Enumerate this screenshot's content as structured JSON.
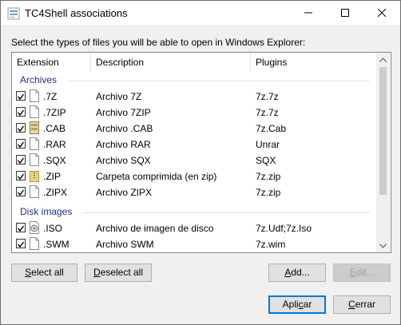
{
  "window": {
    "title": "TC4Shell associations",
    "prompt": "Select the types of files you will be able to open in Windows Explorer:"
  },
  "columns": {
    "extension": "Extension",
    "description": "Description",
    "plugins": "Plugins"
  },
  "groups": [
    {
      "label": "Archives",
      "rows": [
        {
          "ext": ".7Z",
          "desc": "Archivo 7Z",
          "plugin": "7z.7z",
          "checked": true,
          "icon": "document-icon"
        },
        {
          "ext": ".7ZIP",
          "desc": "Archivo 7ZIP",
          "plugin": "7z.7z",
          "checked": true,
          "icon": "document-icon"
        },
        {
          "ext": ".CAB",
          "desc": "Archivo .CAB",
          "plugin": "7z.Cab",
          "checked": true,
          "icon": "cab-file-icon"
        },
        {
          "ext": ".RAR",
          "desc": "Archivo RAR",
          "plugin": "Unrar",
          "checked": true,
          "icon": "document-icon"
        },
        {
          "ext": ".SQX",
          "desc": "Archivo SQX",
          "plugin": "SQX",
          "checked": true,
          "icon": "document-icon"
        },
        {
          "ext": ".ZIP",
          "desc": "Carpeta comprimida (en zip)",
          "plugin": "7z.zip",
          "checked": true,
          "icon": "zip-folder-icon"
        },
        {
          "ext": ".ZIPX",
          "desc": "Archivo ZIPX",
          "plugin": "7z.zip",
          "checked": true,
          "icon": "document-icon"
        }
      ]
    },
    {
      "label": "Disk images",
      "rows": [
        {
          "ext": ".ISO",
          "desc": "Archivo de imagen de disco",
          "plugin": "7z.Udf;7z.Iso",
          "checked": true,
          "icon": "disc-image-icon"
        },
        {
          "ext": ".SWM",
          "desc": "Archivo SWM",
          "plugin": "7z.wim",
          "checked": true,
          "icon": "document-icon"
        }
      ]
    }
  ],
  "buttons": {
    "select_all": {
      "accel": "S",
      "rest": "elect all"
    },
    "deselect_all": {
      "accel": "D",
      "rest": "eselect all"
    },
    "add": {
      "accel": "A",
      "rest": "dd..."
    },
    "edit": {
      "accel": "E",
      "rest": "dit..."
    },
    "apply": {
      "pre": "Apli",
      "accel": "c",
      "post": "ar"
    },
    "close": {
      "accel": "C",
      "rest": "errar"
    }
  },
  "colors": {
    "accent": "#0078d7",
    "group_label": "#1e3287"
  }
}
